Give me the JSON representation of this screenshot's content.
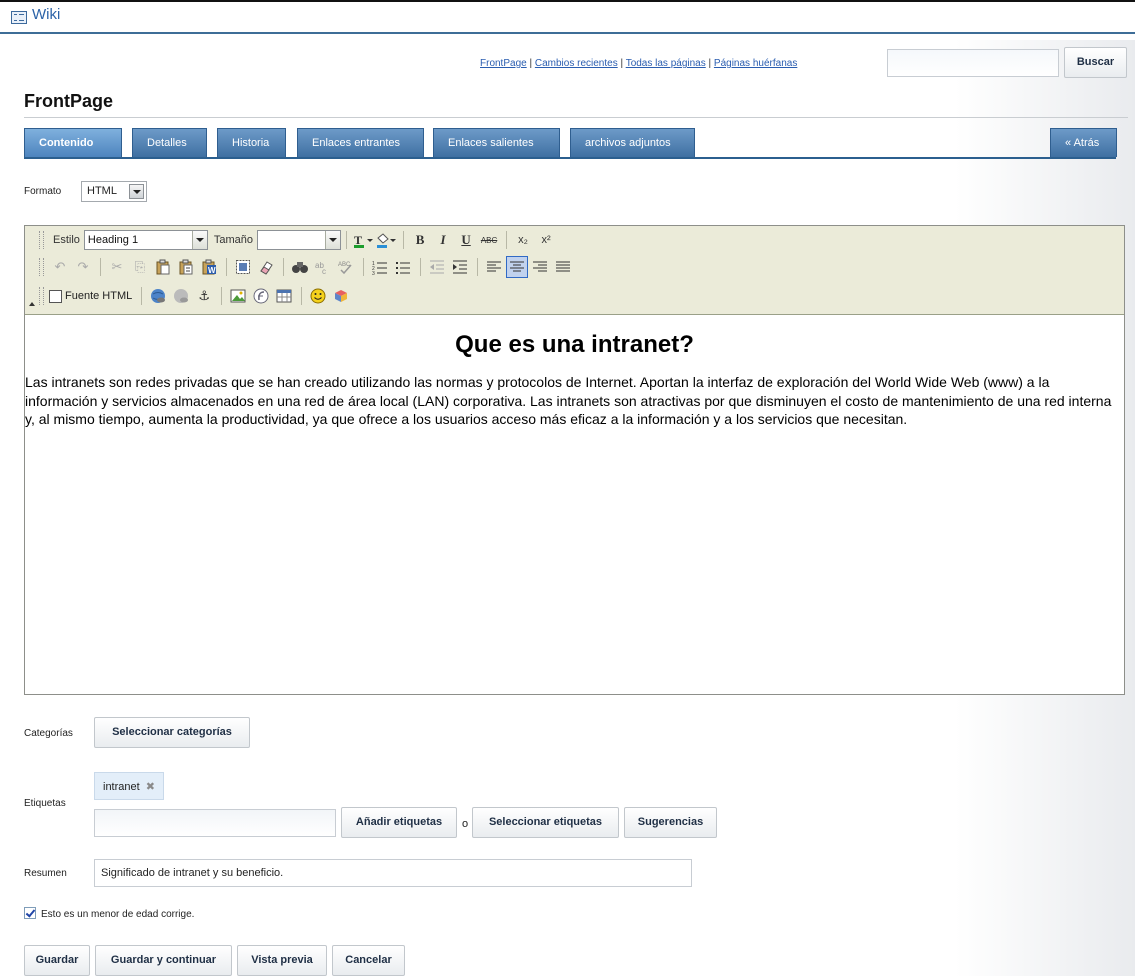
{
  "portlet": {
    "title": "Wiki"
  },
  "nav": {
    "links": [
      "FrontPage",
      "Cambios recientes",
      "Todas las páginas",
      "Páginas huérfanas"
    ],
    "separator": "|",
    "search_value": "",
    "search_button": "Buscar"
  },
  "page": {
    "title": "FrontPage"
  },
  "tabs": {
    "items": [
      "Contenido",
      "Detalles",
      "Historia",
      "Enlaces entrantes",
      "Enlaces salientes",
      "archivos adjuntos"
    ],
    "active": "Contenido",
    "back": "« Atrás"
  },
  "format": {
    "label": "Formato",
    "value": "HTML"
  },
  "editor": {
    "style_label": "Estilo",
    "style_value": "Heading 1",
    "size_label": "Tamaño",
    "size_value": "",
    "source_label": "Fuente HTML",
    "icons": {
      "row1": [
        "text-color",
        "background-color",
        "bold",
        "italic",
        "underline",
        "strikethrough",
        "subscript",
        "superscript"
      ],
      "row2": [
        "undo",
        "redo",
        "cut",
        "copy",
        "paste",
        "paste-text",
        "paste-word",
        "select-all",
        "remove-format",
        "find",
        "replace",
        "spellcheck",
        "numbered-list",
        "bulleted-list",
        "outdent",
        "indent",
        "align-left",
        "align-center",
        "align-right",
        "justify"
      ],
      "row3": [
        "source",
        "link",
        "unlink",
        "anchor",
        "image",
        "flash",
        "table",
        "smiley",
        "special-char"
      ]
    },
    "glyphs": {
      "bold": "B",
      "italic": "I",
      "underline": "U",
      "strike": "ABC",
      "sub": "x₂",
      "sup": "x²",
      "undo": "↶",
      "redo": "↷",
      "cut": "✂",
      "copy": "⎘",
      "paste": "📋",
      "find": "⚲",
      "anchor": "⚓",
      "smiley": "☺"
    },
    "content": {
      "heading": "Que es una intranet?",
      "paragraph": "Las intranets son redes privadas que se han creado utilizando las normas y protocolos de Internet. Aportan la interfaz de exploración del World Wide Web (www) a la información y servicios almacenados en una red de área local (LAN) corporativa. Las intranets son atractivas por que disminuyen el costo de mantenimiento de una red interna y, al mismo tiempo, aumenta la productividad, ya que ofrece a los usuarios acceso más eficaz a la información y a los servicios que necesitan."
    }
  },
  "categories": {
    "label": "Categorías",
    "button": "Seleccionar categorías"
  },
  "tags": {
    "label": "Etiquetas",
    "items": [
      "intranet"
    ],
    "remove_glyph": "✖",
    "input_value": "",
    "add_button": "Añadir etiquetas",
    "or": "o",
    "select_button": "Seleccionar etiquetas",
    "suggest_button": "Sugerencias"
  },
  "summary": {
    "label": "Resumen",
    "value": "Significado de intranet y su beneficio."
  },
  "minor_edit": {
    "label": "Esto es un menor de edad corrige.",
    "checked": true
  },
  "actions": {
    "save": "Guardar",
    "save_continue": "Guardar y continuar",
    "preview": "Vista previa",
    "cancel": "Cancelar"
  }
}
